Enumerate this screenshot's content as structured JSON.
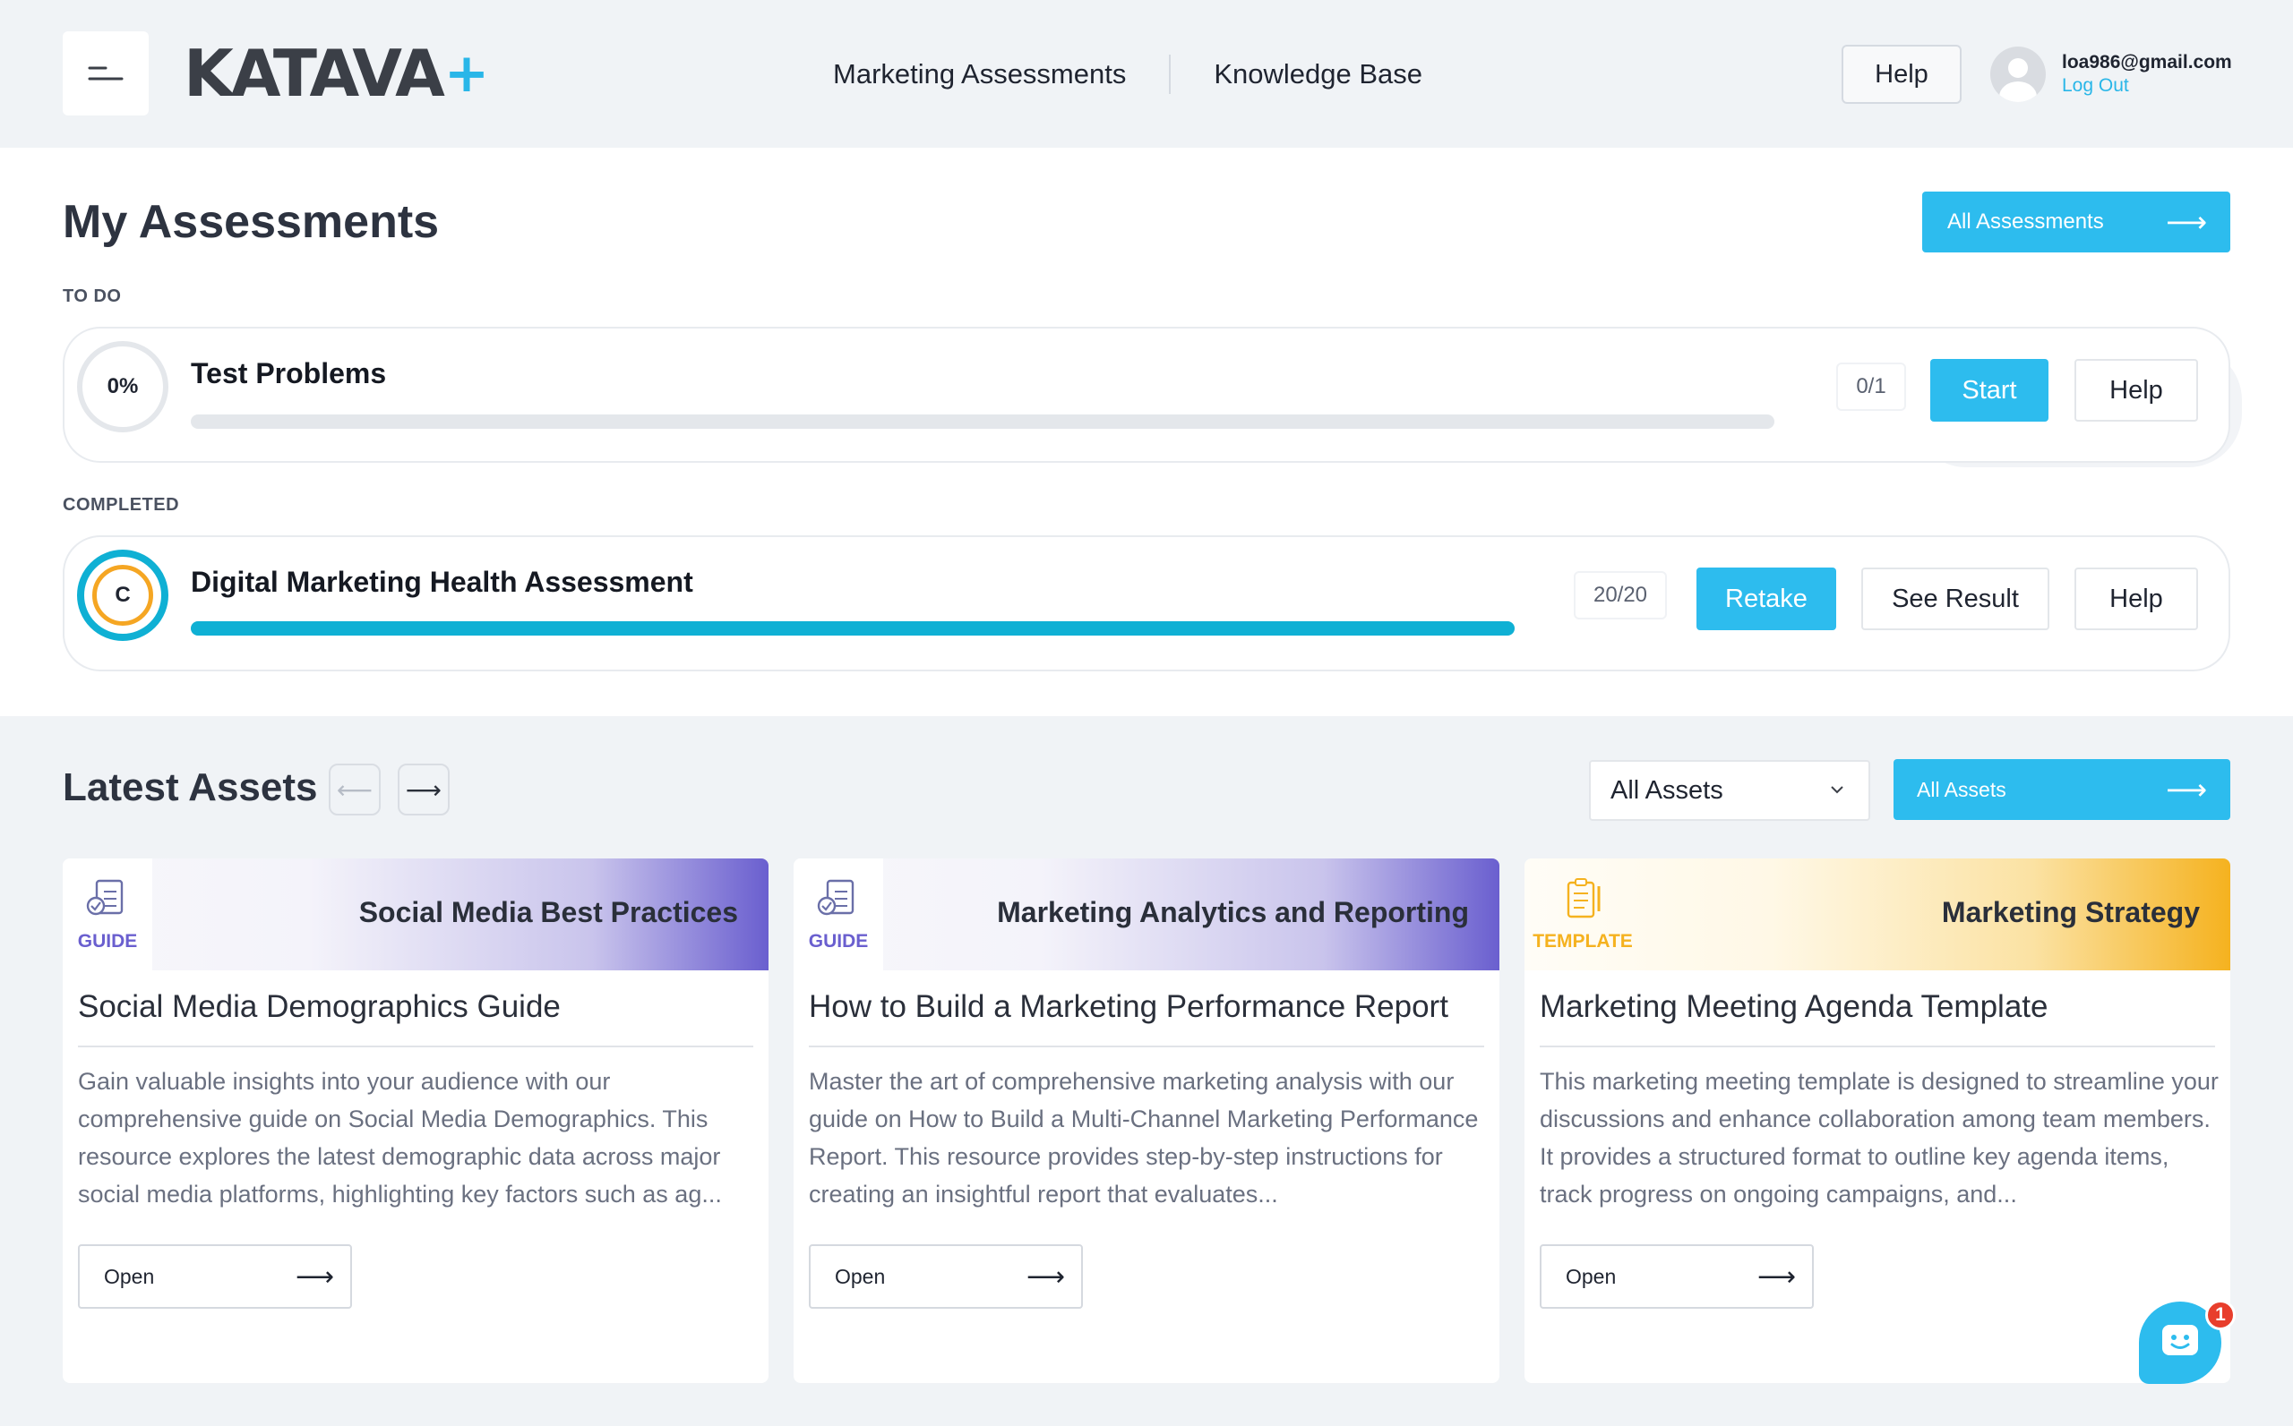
{
  "header": {
    "logo_text": "KATAVA",
    "logo_plus": "+",
    "nav": [
      "Marketing Assessments",
      "Knowledge Base"
    ],
    "help_label": "Help",
    "user_email": "loa986@gmail.com",
    "logout_label": "Log Out"
  },
  "assessments": {
    "title": "My Assessments",
    "all_button": "All Assessments",
    "todo_label": "TO DO",
    "completed_label": "COMPLETED",
    "todo": {
      "progress_label": "0%",
      "progress": 0,
      "title": "Test Problems",
      "score": "0/1",
      "primary_button": "Start",
      "help_button": "Help"
    },
    "completed": {
      "grade": "C",
      "progress": 1.0,
      "title": "Digital Marketing Health Assessment",
      "score": "20/20",
      "primary_button": "Retake",
      "result_button": "See Result",
      "help_button": "Help"
    }
  },
  "assets": {
    "title": "Latest Assets",
    "filter_value": "All Assets",
    "all_button": "All Assets",
    "cards": [
      {
        "type_label": "GUIDE",
        "banner_title": "Social Media Best Practices",
        "title": "Social Media Demographics Guide",
        "description": "Gain valuable insights into your audience with our comprehensive guide on Social Media Demographics. This resource explores the latest demographic data across major social media platforms, highlighting key factors such as ag...",
        "open_label": "Open",
        "accent": "#6a5fcf"
      },
      {
        "type_label": "GUIDE",
        "banner_title": "Marketing Analytics and Reporting",
        "title": "How to Build a Marketing Performance Report",
        "description": "Master the art of comprehensive marketing analysis with our guide on How to Build a Multi-Channel Marketing Performance Report. This resource provides step-by-step instructions for creating an insightful report that evaluates...",
        "open_label": "Open",
        "accent": "#6a5fcf"
      },
      {
        "type_label": "TEMPLATE",
        "banner_title": "Marketing Strategy",
        "title": "Marketing Meeting Agenda Template",
        "description": "This marketing meeting template is designed to streamline your discussions and enhance collaboration among team members. It provides a structured format to outline key agenda items, track progress on ongoing campaigns, and...",
        "open_label": "Open",
        "accent": "#f5b21f"
      }
    ]
  },
  "chat": {
    "badge_count": "1"
  },
  "colors": {
    "primary": "#2dbcee",
    "progress": "#0fb0d4",
    "grade_ring": "#f5a623"
  }
}
